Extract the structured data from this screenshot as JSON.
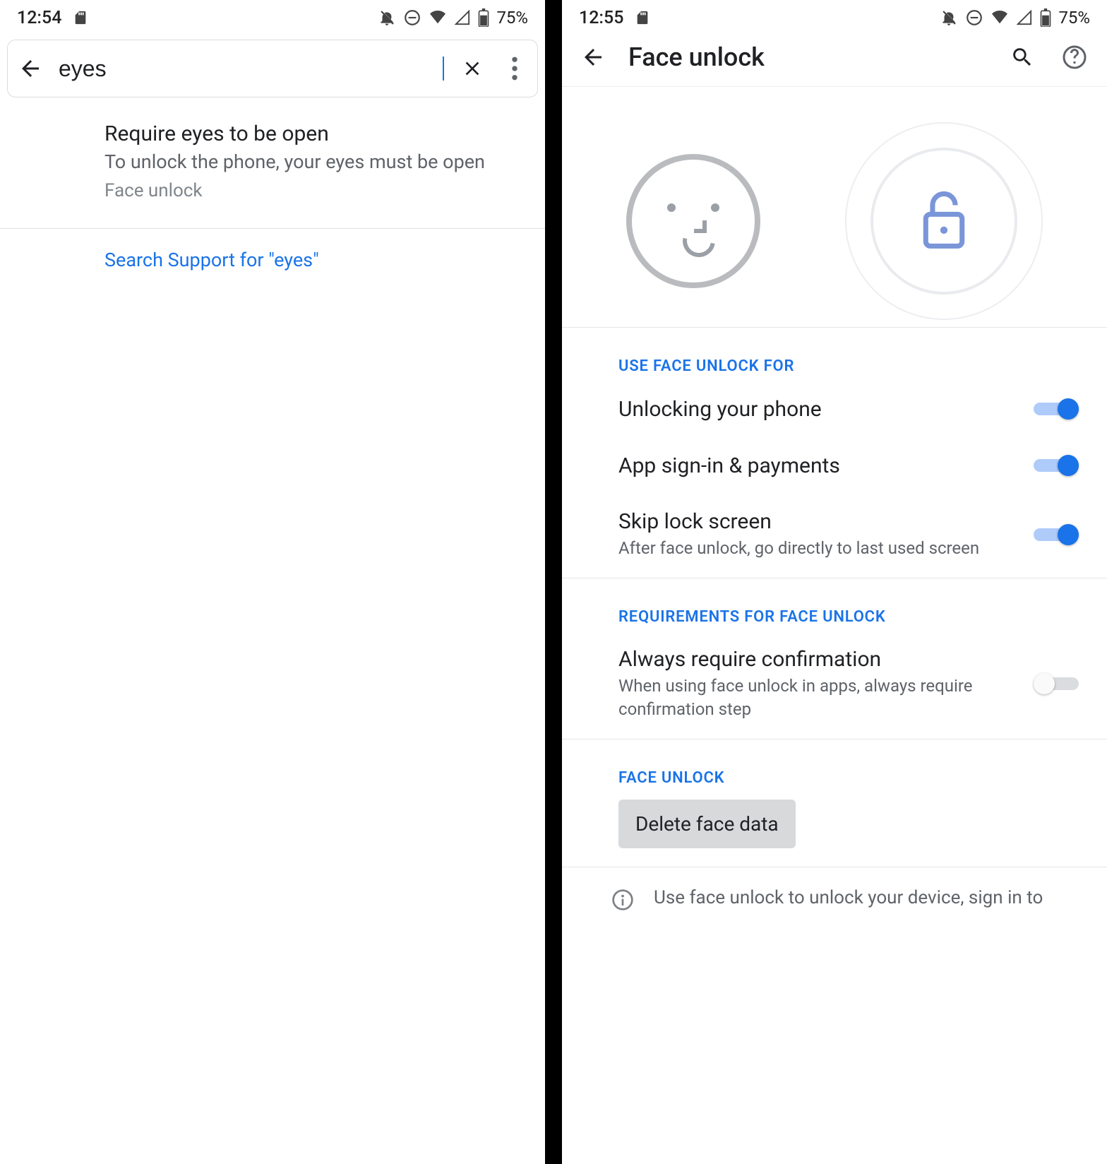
{
  "left": {
    "status": {
      "time": "12:54",
      "battery": "75%"
    },
    "search": {
      "value": "eyes"
    },
    "result": {
      "title": "Require eyes to be open",
      "subtitle": "To unlock the phone, your eyes must be open",
      "breadcrumb": "Face unlock"
    },
    "support_link": "Search Support for \"eyes\""
  },
  "right": {
    "status": {
      "time": "12:55",
      "battery": "75%"
    },
    "page_title": "Face unlock",
    "sections": {
      "use_for": {
        "header": "USE FACE UNLOCK FOR",
        "items": [
          {
            "title": "Unlocking your phone",
            "subtitle": "",
            "on": true
          },
          {
            "title": "App sign-in & payments",
            "subtitle": "",
            "on": true
          },
          {
            "title": "Skip lock screen",
            "subtitle": "After face unlock, go directly to last used screen",
            "on": true
          }
        ]
      },
      "requirements": {
        "header": "REQUIREMENTS FOR FACE UNLOCK",
        "items": [
          {
            "title": "Always require confirmation",
            "subtitle": "When using face unlock in apps, always require confirmation step",
            "on": false
          }
        ]
      },
      "face_unlock": {
        "header": "FACE UNLOCK",
        "delete_label": "Delete face data"
      }
    },
    "footer_text": "Use face unlock to unlock your device, sign in to"
  }
}
